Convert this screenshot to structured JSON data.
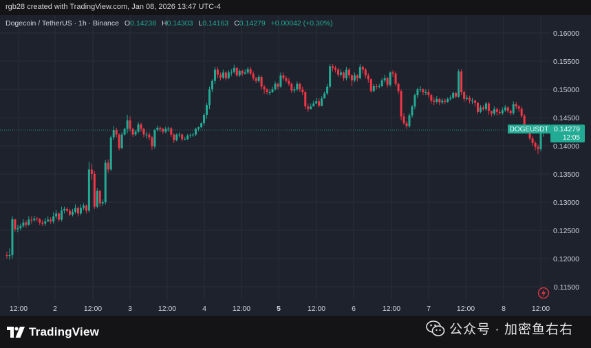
{
  "credit": "rgb28 created with TradingView.com, Jan 08, 2026 13:47 UTC-4",
  "legend": {
    "name": "Dogecoin / TetherUS · 1h · Binance",
    "open_key": "O",
    "open": "0.14238",
    "high_key": "H",
    "high": "0.14303",
    "low_key": "L",
    "low": "0.14163",
    "close_key": "C",
    "close": "0.14279",
    "change": "+0.00042 (+0.30%)"
  },
  "price_tag": {
    "symbol": "DOGEUSDT",
    "price": "0.14279",
    "countdown": "12:05"
  },
  "footer": {
    "logo_text": "TradingView",
    "wechat_text": "公众号 · 加密鱼右右"
  },
  "colors": {
    "up": "#22ab94",
    "down": "#f23645",
    "background": "#1e222d",
    "grid": "#2a2e39",
    "text": "#d1d4dc"
  },
  "icons": [
    "lightning-icon",
    "tradingview-logo-icon",
    "wechat-icon"
  ],
  "chart_data": {
    "type": "candlestick",
    "title": "Dogecoin / TetherUS · 1h · Binance",
    "ylim": [
      0.1125,
      0.1615
    ],
    "y_ticks": [
      "0.16000",
      "0.15500",
      "0.15000",
      "0.14500",
      "0.14000",
      "0.13500",
      "0.13000",
      "0.12500",
      "0.12000",
      "0.11500"
    ],
    "y_tick_values": [
      0.16,
      0.155,
      0.15,
      0.145,
      0.14,
      0.135,
      0.13,
      0.125,
      0.12,
      0.115
    ],
    "x_tick_labels": [
      "12:00",
      "2",
      "12:00",
      "3",
      "12:00",
      "4",
      "12:00",
      "5",
      "12:00",
      "6",
      "12:00",
      "7",
      "12:00",
      "8",
      "12:00"
    ],
    "x_tick_bold": [
      "5"
    ],
    "grid": true,
    "last_price": 0.14279,
    "closes": [
      0.1205,
      0.1206,
      0.127,
      0.1252,
      0.1254,
      0.1258,
      0.1264,
      0.126,
      0.1269,
      0.1268,
      0.1271,
      0.127,
      0.1264,
      0.1262,
      0.1266,
      0.1269,
      0.1266,
      0.1275,
      0.128,
      0.1269,
      0.1285,
      0.1288,
      0.1285,
      0.1278,
      0.1283,
      0.129,
      0.128,
      0.129,
      0.1294,
      0.1285,
      0.1358,
      0.135,
      0.1292,
      0.132,
      0.1298,
      0.13,
      0.137,
      0.1358,
      0.1415,
      0.1428,
      0.142,
      0.1396,
      0.142,
      0.143,
      0.1445,
      0.143,
      0.142,
      0.1425,
      0.1438,
      0.143,
      0.142,
      0.142,
      0.1415,
      0.1399,
      0.1428,
      0.1432,
      0.143,
      0.1425,
      0.143,
      0.1431,
      0.142,
      0.141,
      0.142,
      0.142,
      0.1412,
      0.1412,
      0.1418,
      0.1419,
      0.142,
      0.143,
      0.1433,
      0.144,
      0.1455,
      0.1472,
      0.15,
      0.1515,
      0.1535,
      0.1526,
      0.1521,
      0.153,
      0.152,
      0.153,
      0.1531,
      0.1538,
      0.1525,
      0.1533,
      0.1528,
      0.153,
      0.1536,
      0.1528,
      0.152,
      0.1515,
      0.1522,
      0.1505,
      0.15,
      0.1495,
      0.1495,
      0.15,
      0.151,
      0.1505,
      0.1525,
      0.152,
      0.1515,
      0.151,
      0.1498,
      0.15,
      0.151,
      0.15,
      0.1495,
      0.147,
      0.1465,
      0.147,
      0.1475,
      0.1479,
      0.1471,
      0.1484,
      0.1493,
      0.1505,
      0.1541,
      0.1538,
      0.1535,
      0.1526,
      0.153,
      0.152,
      0.1535,
      0.1525,
      0.1516,
      0.1525,
      0.152,
      0.154,
      0.1535,
      0.1525,
      0.1518,
      0.1497,
      0.1506,
      0.1505,
      0.1506,
      0.1516,
      0.152,
      0.1508,
      0.153,
      0.1528,
      0.151,
      0.1497,
      0.1452,
      0.144,
      0.1435,
      0.1454,
      0.147,
      0.149,
      0.15,
      0.15,
      0.1495,
      0.1495,
      0.149,
      0.148,
      0.1478,
      0.1483,
      0.1477,
      0.148,
      0.1478,
      0.1483,
      0.1485,
      0.1494,
      0.1487,
      0.1532,
      0.1495,
      0.1483,
      0.1485,
      0.148,
      0.148,
      0.1476,
      0.146,
      0.1468,
      0.1465,
      0.1475,
      0.1462,
      0.1457,
      0.1465,
      0.146,
      0.1458,
      0.1463,
      0.1468,
      0.1462,
      0.1458,
      0.1474,
      0.147,
      0.1466,
      0.1453,
      0.1432,
      0.1428,
      0.1413,
      0.1405,
      0.1398,
      0.1394,
      0.14238,
      0.14279
    ],
    "opens_first": 0.1206,
    "wicks": [
      [
        0.12,
        0.1212
      ],
      [
        0.1198,
        0.1218
      ],
      [
        0.12,
        0.1275
      ],
      [
        0.1248,
        0.127
      ],
      [
        0.1247,
        0.126
      ],
      [
        0.125,
        0.1262
      ],
      [
        0.1255,
        0.127
      ],
      [
        0.1255,
        0.1268
      ],
      [
        0.1258,
        0.1275
      ],
      [
        0.1262,
        0.1275
      ],
      [
        0.1265,
        0.1276
      ],
      [
        0.1266,
        0.1274
      ],
      [
        0.126,
        0.1272
      ],
      [
        0.1258,
        0.1268
      ],
      [
        0.1258,
        0.1272
      ],
      [
        0.1265,
        0.1275
      ],
      [
        0.1262,
        0.1273
      ],
      [
        0.1262,
        0.1282
      ],
      [
        0.127,
        0.1286
      ],
      [
        0.1265,
        0.1282
      ],
      [
        0.1266,
        0.1292
      ],
      [
        0.128,
        0.1292
      ],
      [
        0.1282,
        0.1291
      ],
      [
        0.1275,
        0.1288
      ],
      [
        0.1275,
        0.1288
      ],
      [
        0.128,
        0.1296
      ],
      [
        0.1275,
        0.1292
      ],
      [
        0.1277,
        0.1296
      ],
      [
        0.1286,
        0.1298
      ],
      [
        0.128,
        0.1296
      ],
      [
        0.1282,
        0.1372
      ],
      [
        0.134,
        0.1368
      ],
      [
        0.1288,
        0.1355
      ],
      [
        0.1289,
        0.1325
      ],
      [
        0.1292,
        0.1322
      ],
      [
        0.1294,
        0.1305
      ],
      [
        0.1296,
        0.1375
      ],
      [
        0.1352,
        0.1376
      ],
      [
        0.1355,
        0.1418
      ],
      [
        0.141,
        0.1435
      ],
      [
        0.1415,
        0.1432
      ],
      [
        0.1392,
        0.1422
      ],
      [
        0.1394,
        0.1424
      ],
      [
        0.1418,
        0.1432
      ],
      [
        0.1422,
        0.1455
      ],
      [
        0.1425,
        0.1452
      ],
      [
        0.1416,
        0.1432
      ],
      [
        0.1417,
        0.1428
      ],
      [
        0.1422,
        0.1442
      ],
      [
        0.1425,
        0.1441
      ],
      [
        0.1415,
        0.1432
      ],
      [
        0.1413,
        0.1425
      ],
      [
        0.141,
        0.1424
      ],
      [
        0.1393,
        0.1417
      ],
      [
        0.1395,
        0.143
      ],
      [
        0.1425,
        0.1436
      ],
      [
        0.1425,
        0.1434
      ],
      [
        0.1421,
        0.1432
      ],
      [
        0.1422,
        0.1434
      ],
      [
        0.1425,
        0.1434
      ],
      [
        0.1416,
        0.1433
      ],
      [
        0.1405,
        0.1422
      ],
      [
        0.1408,
        0.1422
      ],
      [
        0.1415,
        0.1424
      ],
      [
        0.1408,
        0.1422
      ],
      [
        0.141,
        0.1416
      ],
      [
        0.141,
        0.1421
      ],
      [
        0.1414,
        0.1422
      ],
      [
        0.1416,
        0.1423
      ],
      [
        0.1417,
        0.1432
      ],
      [
        0.1426,
        0.1434
      ],
      [
        0.1431,
        0.1442
      ],
      [
        0.1436,
        0.1458
      ],
      [
        0.1448,
        0.1476
      ],
      [
        0.1465,
        0.1505
      ],
      [
        0.1495,
        0.1518
      ],
      [
        0.151,
        0.154
      ],
      [
        0.152,
        0.154
      ],
      [
        0.1516,
        0.153
      ],
      [
        0.1518,
        0.1535
      ],
      [
        0.1516,
        0.1532
      ],
      [
        0.1518,
        0.1534
      ],
      [
        0.1524,
        0.1536
      ],
      [
        0.1528,
        0.1544
      ],
      [
        0.1522,
        0.154
      ],
      [
        0.1522,
        0.1536
      ],
      [
        0.1524,
        0.1535
      ],
      [
        0.1526,
        0.1536
      ],
      [
        0.1527,
        0.154
      ],
      [
        0.1525,
        0.154
      ],
      [
        0.1516,
        0.1532
      ],
      [
        0.1511,
        0.1522
      ],
      [
        0.1512,
        0.1526
      ],
      [
        0.15,
        0.1525
      ],
      [
        0.1492,
        0.1508
      ],
      [
        0.1491,
        0.1502
      ],
      [
        0.149,
        0.15
      ],
      [
        0.1494,
        0.1505
      ],
      [
        0.1498,
        0.1514
      ],
      [
        0.15,
        0.1512
      ],
      [
        0.1503,
        0.153
      ],
      [
        0.1516,
        0.153
      ],
      [
        0.1512,
        0.1524
      ],
      [
        0.1506,
        0.152
      ],
      [
        0.1494,
        0.1512
      ],
      [
        0.1494,
        0.1505
      ],
      [
        0.1497,
        0.1514
      ],
      [
        0.1495,
        0.1512
      ],
      [
        0.149,
        0.1505
      ],
      [
        0.1465,
        0.1498
      ],
      [
        0.146,
        0.1475
      ],
      [
        0.1464,
        0.1475
      ],
      [
        0.147,
        0.148
      ],
      [
        0.1474,
        0.1485
      ],
      [
        0.1468,
        0.1484
      ],
      [
        0.147,
        0.1488
      ],
      [
        0.1486,
        0.1496
      ],
      [
        0.149,
        0.151
      ],
      [
        0.1502,
        0.1545
      ],
      [
        0.1532,
        0.1545
      ],
      [
        0.153,
        0.1542
      ],
      [
        0.1522,
        0.1538
      ],
      [
        0.1523,
        0.1536
      ],
      [
        0.1515,
        0.1532
      ],
      [
        0.1516,
        0.154
      ],
      [
        0.152,
        0.1538
      ],
      [
        0.1506,
        0.1527
      ],
      [
        0.1513,
        0.153
      ],
      [
        0.1514,
        0.1527
      ],
      [
        0.1518,
        0.1545
      ],
      [
        0.1528,
        0.1542
      ],
      [
        0.152,
        0.1538
      ],
      [
        0.1512,
        0.1529
      ],
      [
        0.1494,
        0.152
      ],
      [
        0.1495,
        0.151
      ],
      [
        0.15,
        0.151
      ],
      [
        0.1502,
        0.151
      ],
      [
        0.1504,
        0.152
      ],
      [
        0.1512,
        0.1526
      ],
      [
        0.1503,
        0.1522
      ],
      [
        0.1505,
        0.1532
      ],
      [
        0.1522,
        0.1534
      ],
      [
        0.1506,
        0.1532
      ],
      [
        0.1492,
        0.1512
      ],
      [
        0.1445,
        0.15
      ],
      [
        0.1437,
        0.1458
      ],
      [
        0.143,
        0.1444
      ],
      [
        0.1432,
        0.1458
      ],
      [
        0.145,
        0.1472
      ],
      [
        0.1465,
        0.1493
      ],
      [
        0.1485,
        0.1503
      ],
      [
        0.1495,
        0.1506
      ],
      [
        0.149,
        0.1502
      ],
      [
        0.149,
        0.15
      ],
      [
        0.1485,
        0.15
      ],
      [
        0.1475,
        0.1492
      ],
      [
        0.1472,
        0.1486
      ],
      [
        0.1475,
        0.1488
      ],
      [
        0.1472,
        0.1485
      ],
      [
        0.1474,
        0.1484
      ],
      [
        0.1474,
        0.1484
      ],
      [
        0.1476,
        0.1486
      ],
      [
        0.148,
        0.149
      ],
      [
        0.1483,
        0.1496
      ],
      [
        0.1484,
        0.1495
      ],
      [
        0.1485,
        0.1536
      ],
      [
        0.149,
        0.1536
      ],
      [
        0.1478,
        0.1498
      ],
      [
        0.148,
        0.149
      ],
      [
        0.1475,
        0.1489
      ],
      [
        0.1474,
        0.1485
      ],
      [
        0.147,
        0.1482
      ],
      [
        0.1456,
        0.1478
      ],
      [
        0.1458,
        0.1472
      ],
      [
        0.1462,
        0.1472
      ],
      [
        0.1462,
        0.1478
      ],
      [
        0.1455,
        0.1478
      ],
      [
        0.1452,
        0.1462
      ],
      [
        0.1454,
        0.147
      ],
      [
        0.1454,
        0.1468
      ],
      [
        0.1455,
        0.1465
      ],
      [
        0.1455,
        0.1468
      ],
      [
        0.146,
        0.1472
      ],
      [
        0.1458,
        0.147
      ],
      [
        0.1454,
        0.1465
      ],
      [
        0.1455,
        0.1479
      ],
      [
        0.1465,
        0.1478
      ],
      [
        0.146,
        0.1472
      ],
      [
        0.145,
        0.147
      ],
      [
        0.1428,
        0.1456
      ],
      [
        0.1425,
        0.1436
      ],
      [
        0.141,
        0.1432
      ],
      [
        0.14,
        0.1418
      ],
      [
        0.1392,
        0.1408
      ],
      [
        0.1385,
        0.1402
      ],
      [
        0.139,
        0.1426
      ],
      [
        0.14163,
        0.14303
      ]
    ]
  }
}
